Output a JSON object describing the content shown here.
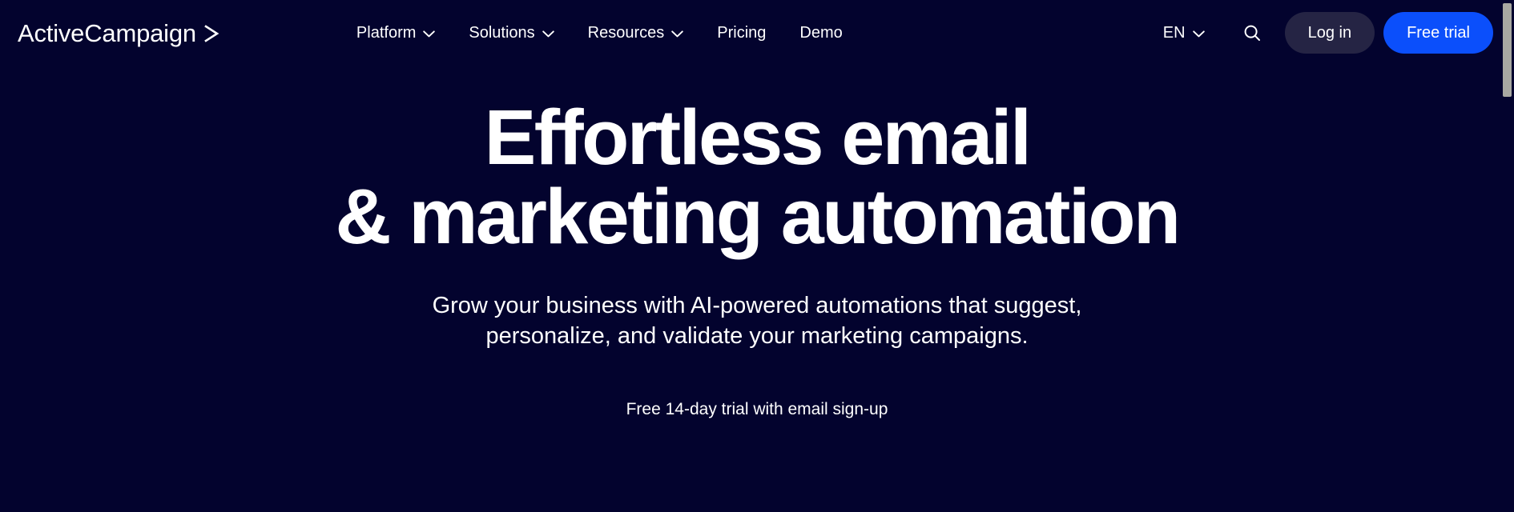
{
  "theme": {
    "background": "#03032e",
    "text": "#ffffff",
    "accent_blue": "#0b4ffb",
    "login_button_bg": "#252444",
    "scrollbar_thumb": "#a8a8a2"
  },
  "header": {
    "logo": {
      "text": "ActiveCampaign",
      "icon": "chevron-right-logo-icon"
    },
    "nav": [
      {
        "label": "Platform",
        "has_dropdown": true,
        "icon": "chevron-down-icon"
      },
      {
        "label": "Solutions",
        "has_dropdown": true,
        "icon": "chevron-down-icon"
      },
      {
        "label": "Resources",
        "has_dropdown": true,
        "icon": "chevron-down-icon"
      },
      {
        "label": "Pricing",
        "has_dropdown": false,
        "icon": ""
      },
      {
        "label": "Demo",
        "has_dropdown": false,
        "icon": ""
      }
    ],
    "language": {
      "label": "EN",
      "icon": "chevron-down-icon"
    },
    "search": {
      "icon": "search-icon"
    },
    "login_label": "Log in",
    "trial_label": "Free trial"
  },
  "hero": {
    "title_line_1": "Effortless email",
    "title_line_2": "& marketing automation",
    "subtitle": "Grow your business with AI-powered automations that suggest, personalize, and validate your marketing campaigns.",
    "note": "Free 14-day trial with email sign-up"
  },
  "scrollbar": {
    "name": "vertical-scrollbar"
  }
}
